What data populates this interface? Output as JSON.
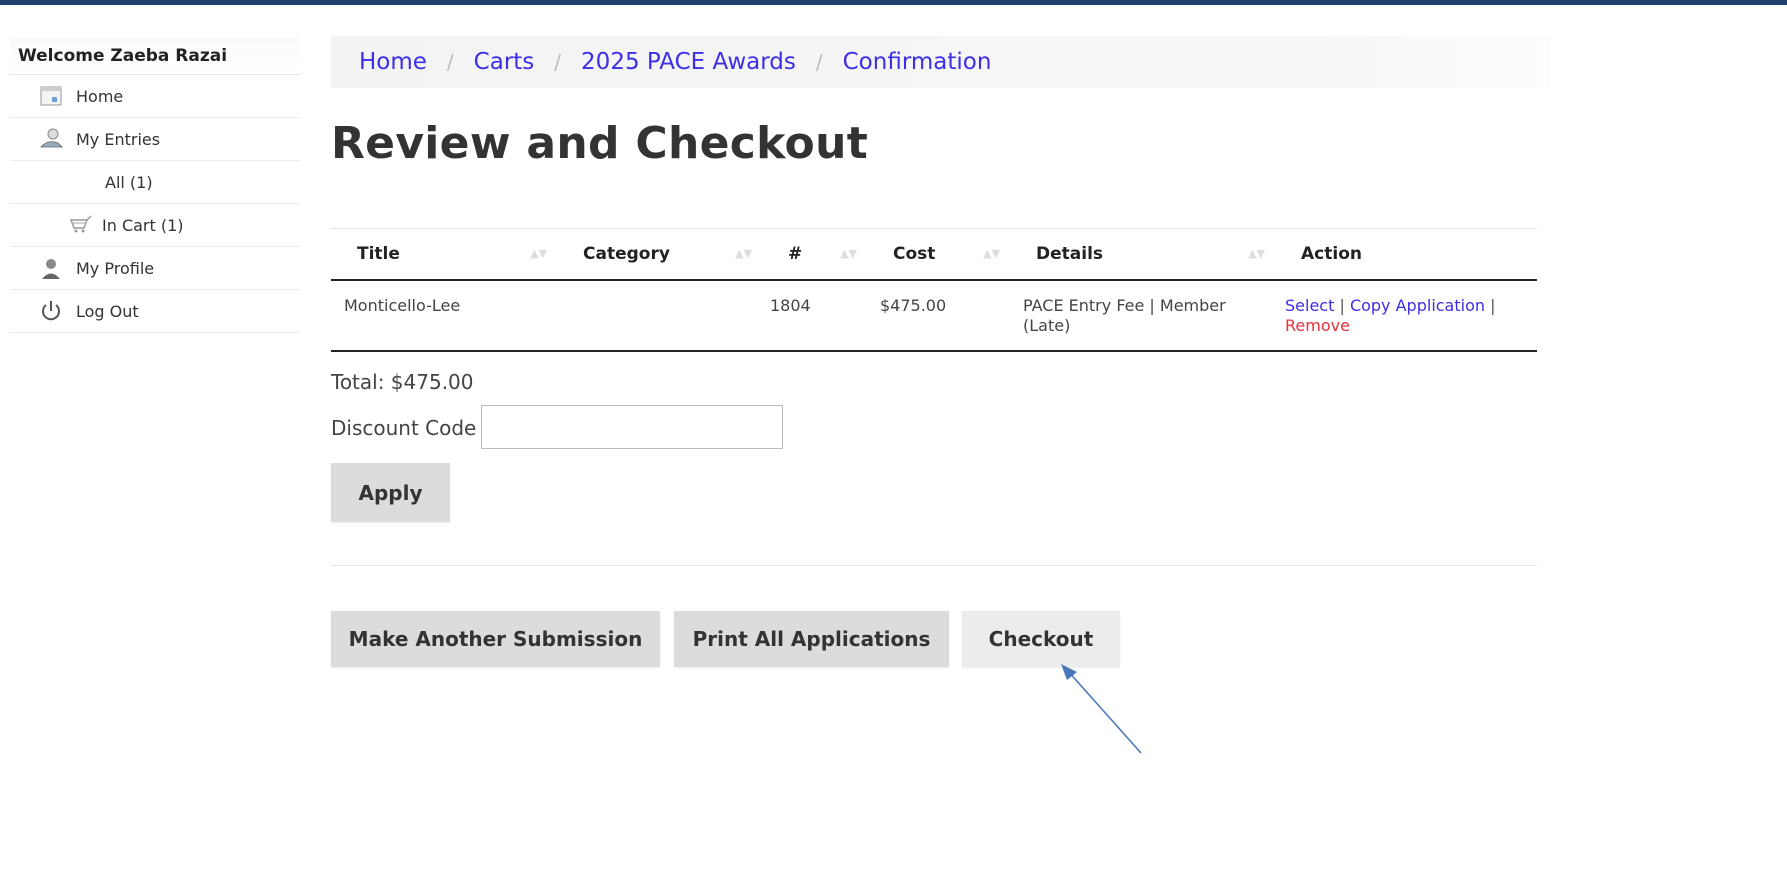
{
  "sidebar": {
    "welcome": "Welcome Zaeba Razai",
    "items": [
      {
        "label": "Home",
        "icon": "home-icon"
      },
      {
        "label": "My Entries",
        "icon": "entries-icon"
      },
      {
        "label": "All (1)"
      },
      {
        "label": "In Cart (1)",
        "icon": "cart-icon"
      },
      {
        "label": "My Profile",
        "icon": "profile-icon"
      },
      {
        "label": "Log Out",
        "icon": "power-icon"
      }
    ]
  },
  "breadcrumb": [
    "Home",
    "Carts",
    "2025 PACE Awards",
    "Confirmation"
  ],
  "page_title": "Review and Checkout",
  "table": {
    "headers": [
      "Title",
      "Category",
      "#",
      "Cost",
      "Details",
      "Action"
    ],
    "rows": [
      {
        "title": "Monticello-Lee",
        "category": "",
        "number": "1804",
        "cost": "$475.00",
        "details_line1": "PACE Entry Fee | Member",
        "details_line2": "(Late)",
        "actions": {
          "select": "Select",
          "copy": "Copy Application",
          "remove": "Remove"
        }
      }
    ]
  },
  "total": "Total: $475.00",
  "discount": {
    "label": "Discount Code",
    "value": "",
    "placeholder": ""
  },
  "buttons": {
    "apply": "Apply",
    "make_another": "Make Another Submission",
    "print_all": "Print All Applications",
    "checkout": "Checkout"
  },
  "colors": {
    "link": "#3d2ee8",
    "remove": "#e8323c",
    "topbar": "#1f3f6e",
    "button": "#dcdcdc",
    "arrow": "#4a78b8"
  }
}
